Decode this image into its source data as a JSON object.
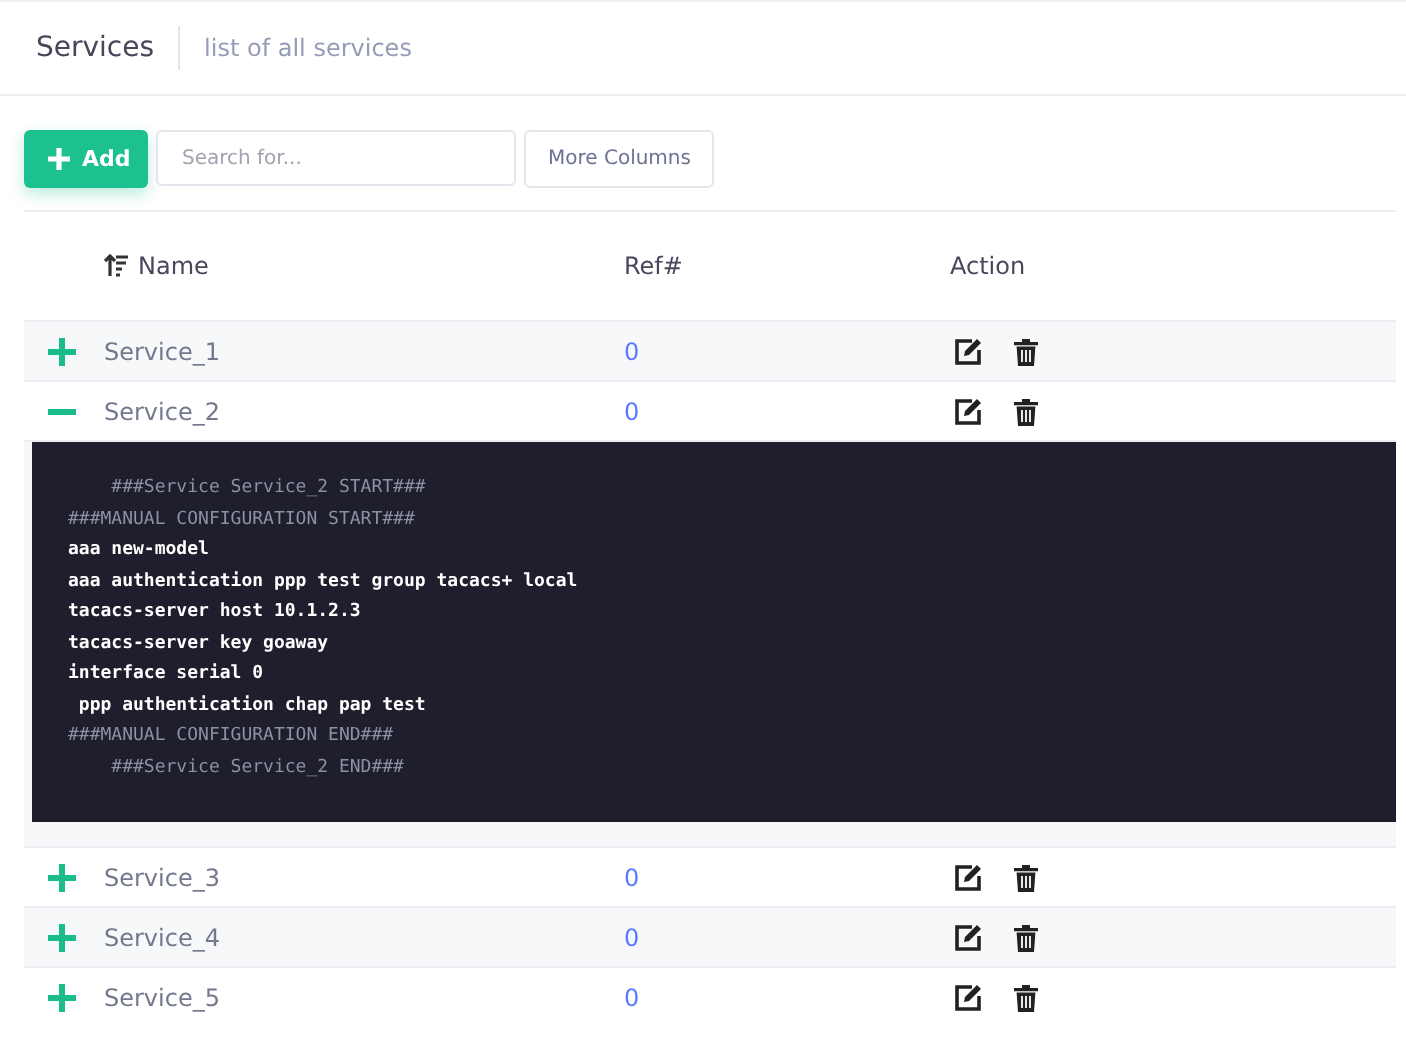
{
  "header": {
    "title": "Services",
    "subtitle": "list of all services"
  },
  "toolbar": {
    "add_button": "Add",
    "search": {
      "placeholder": "Search for..."
    },
    "columns_button": "More Columns"
  },
  "table": {
    "columns": [
      "Name",
      "Ref#",
      "Action"
    ],
    "rows": [
      {
        "name": "Service_1",
        "ref": "0",
        "expanded": false
      },
      {
        "name": "Service_2",
        "ref": "0",
        "expanded": true,
        "config": [
          {
            "kind": "comment",
            "text": "    ###Service Service_2 START###"
          },
          {
            "kind": "comment",
            "text": "###MANUAL CONFIGURATION START###"
          },
          {
            "kind": "command",
            "text": "aaa new-model"
          },
          {
            "kind": "command",
            "text": "aaa authentication ppp test group tacacs+ local"
          },
          {
            "kind": "command",
            "text": "tacacs-server host 10.1.2.3"
          },
          {
            "kind": "command",
            "text": "tacacs-server key goaway"
          },
          {
            "kind": "command",
            "text": "interface serial 0"
          },
          {
            "kind": "command",
            "text": " ppp authentication chap pap test"
          },
          {
            "kind": "comment",
            "text": "###MANUAL CONFIGURATION END###"
          },
          {
            "kind": "comment",
            "text": "    ###Service Service_2 END###"
          }
        ]
      },
      {
        "name": "Service_3",
        "ref": "0",
        "expanded": false
      },
      {
        "name": "Service_4",
        "ref": "0",
        "expanded": false
      },
      {
        "name": "Service_5",
        "ref": "0",
        "expanded": false
      }
    ]
  }
}
